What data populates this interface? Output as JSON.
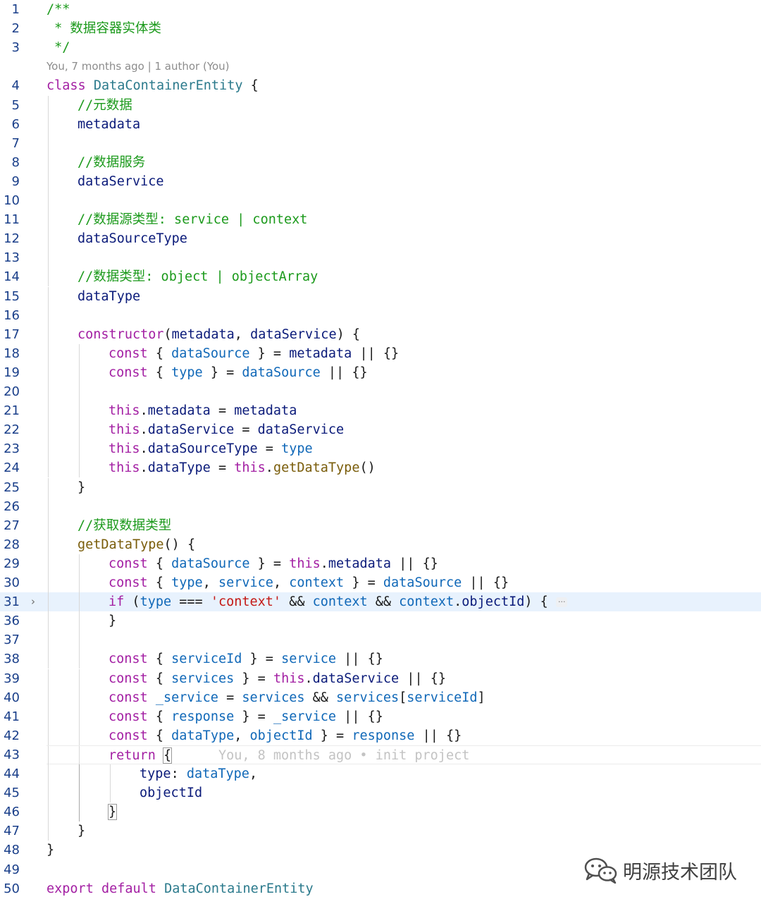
{
  "colors": {
    "keyword": "#a31fa3",
    "plain": "#0b1b7a",
    "property": "#1068b8",
    "type": "#2b7a8c",
    "comment": "#1c9a1c",
    "string": "#c41a16",
    "function": "#7a5d0b",
    "punct": "#1a1a1a",
    "blame": "#c3c3c3"
  },
  "codelens": {
    "after_line": 3,
    "text": "You, 7 months ago | 1 author (You)"
  },
  "inline_blame": "You, 8 months ago • init project",
  "watermark": {
    "icon": "wechat-icon",
    "text": "明源技术团队"
  },
  "lines": [
    {
      "n": "1",
      "indent": 0,
      "tokens": [
        {
          "t": "/**",
          "c": "comment"
        }
      ]
    },
    {
      "n": "2",
      "indent": 0,
      "tokens": [
        {
          "t": " * 数据容器实体类",
          "c": "comment"
        }
      ]
    },
    {
      "n": "3",
      "indent": 0,
      "tokens": [
        {
          "t": " */",
          "c": "comment"
        }
      ]
    },
    {
      "n": "4",
      "indent": 0,
      "tokens": [
        {
          "t": "class",
          "c": "keyword"
        },
        {
          "t": " ",
          "c": "punct"
        },
        {
          "t": "DataContainerEntity",
          "c": "type"
        },
        {
          "t": " {",
          "c": "punct"
        }
      ]
    },
    {
      "n": "5",
      "indent": 1,
      "tokens": [
        {
          "t": "//元数据",
          "c": "comment"
        }
      ]
    },
    {
      "n": "6",
      "indent": 1,
      "tokens": [
        {
          "t": "metadata",
          "c": "plain"
        }
      ]
    },
    {
      "n": "7",
      "indent": 1,
      "tokens": []
    },
    {
      "n": "8",
      "indent": 1,
      "tokens": [
        {
          "t": "//数据服务",
          "c": "comment"
        }
      ]
    },
    {
      "n": "9",
      "indent": 1,
      "tokens": [
        {
          "t": "dataService",
          "c": "plain"
        }
      ]
    },
    {
      "n": "10",
      "indent": 1,
      "tokens": []
    },
    {
      "n": "11",
      "indent": 1,
      "tokens": [
        {
          "t": "//数据源类型: service | context",
          "c": "comment"
        }
      ]
    },
    {
      "n": "12",
      "indent": 1,
      "tokens": [
        {
          "t": "dataSourceType",
          "c": "plain"
        }
      ]
    },
    {
      "n": "13",
      "indent": 1,
      "tokens": []
    },
    {
      "n": "14",
      "indent": 1,
      "tokens": [
        {
          "t": "//数据类型: object | objectArray",
          "c": "comment"
        }
      ]
    },
    {
      "n": "15",
      "indent": 1,
      "tokens": [
        {
          "t": "dataType",
          "c": "plain"
        }
      ]
    },
    {
      "n": "16",
      "indent": 1,
      "tokens": []
    },
    {
      "n": "17",
      "indent": 1,
      "tokens": [
        {
          "t": "constructor",
          "c": "keyword"
        },
        {
          "t": "(",
          "c": "punct"
        },
        {
          "t": "metadata",
          "c": "plain"
        },
        {
          "t": ", ",
          "c": "punct"
        },
        {
          "t": "dataService",
          "c": "plain"
        },
        {
          "t": ") {",
          "c": "punct"
        }
      ]
    },
    {
      "n": "18",
      "indent": 2,
      "tokens": [
        {
          "t": "const",
          "c": "keyword"
        },
        {
          "t": " { ",
          "c": "punct"
        },
        {
          "t": "dataSource",
          "c": "property"
        },
        {
          "t": " } = ",
          "c": "punct"
        },
        {
          "t": "metadata",
          "c": "plain"
        },
        {
          "t": " || {}",
          "c": "punct"
        }
      ]
    },
    {
      "n": "19",
      "indent": 2,
      "tokens": [
        {
          "t": "const",
          "c": "keyword"
        },
        {
          "t": " { ",
          "c": "punct"
        },
        {
          "t": "type",
          "c": "property"
        },
        {
          "t": " } = ",
          "c": "punct"
        },
        {
          "t": "dataSource",
          "c": "property"
        },
        {
          "t": " || {}",
          "c": "punct"
        }
      ]
    },
    {
      "n": "20",
      "indent": 2,
      "tokens": []
    },
    {
      "n": "21",
      "indent": 2,
      "tokens": [
        {
          "t": "this",
          "c": "keyword"
        },
        {
          "t": ".",
          "c": "punct"
        },
        {
          "t": "metadata",
          "c": "plain"
        },
        {
          "t": " = ",
          "c": "punct"
        },
        {
          "t": "metadata",
          "c": "plain"
        }
      ]
    },
    {
      "n": "22",
      "indent": 2,
      "tokens": [
        {
          "t": "this",
          "c": "keyword"
        },
        {
          "t": ".",
          "c": "punct"
        },
        {
          "t": "dataService",
          "c": "plain"
        },
        {
          "t": " = ",
          "c": "punct"
        },
        {
          "t": "dataService",
          "c": "plain"
        }
      ]
    },
    {
      "n": "23",
      "indent": 2,
      "tokens": [
        {
          "t": "this",
          "c": "keyword"
        },
        {
          "t": ".",
          "c": "punct"
        },
        {
          "t": "dataSourceType",
          "c": "plain"
        },
        {
          "t": " = ",
          "c": "punct"
        },
        {
          "t": "type",
          "c": "property"
        }
      ]
    },
    {
      "n": "24",
      "indent": 2,
      "tokens": [
        {
          "t": "this",
          "c": "keyword"
        },
        {
          "t": ".",
          "c": "punct"
        },
        {
          "t": "dataType",
          "c": "plain"
        },
        {
          "t": " = ",
          "c": "punct"
        },
        {
          "t": "this",
          "c": "keyword"
        },
        {
          "t": ".",
          "c": "punct"
        },
        {
          "t": "getDataType",
          "c": "function"
        },
        {
          "t": "()",
          "c": "punct"
        }
      ]
    },
    {
      "n": "25",
      "indent": 1,
      "tokens": [
        {
          "t": "}",
          "c": "punct"
        }
      ]
    },
    {
      "n": "26",
      "indent": 1,
      "tokens": []
    },
    {
      "n": "27",
      "indent": 1,
      "tokens": [
        {
          "t": "//获取数据类型",
          "c": "comment"
        }
      ]
    },
    {
      "n": "28",
      "indent": 1,
      "tokens": [
        {
          "t": "getDataType",
          "c": "function"
        },
        {
          "t": "() {",
          "c": "punct"
        }
      ]
    },
    {
      "n": "29",
      "indent": 2,
      "tokens": [
        {
          "t": "const",
          "c": "keyword"
        },
        {
          "t": " { ",
          "c": "punct"
        },
        {
          "t": "dataSource",
          "c": "property"
        },
        {
          "t": " } = ",
          "c": "punct"
        },
        {
          "t": "this",
          "c": "keyword"
        },
        {
          "t": ".",
          "c": "punct"
        },
        {
          "t": "metadata",
          "c": "plain"
        },
        {
          "t": " || {}",
          "c": "punct"
        }
      ]
    },
    {
      "n": "30",
      "indent": 2,
      "tokens": [
        {
          "t": "const",
          "c": "keyword"
        },
        {
          "t": " { ",
          "c": "punct"
        },
        {
          "t": "type",
          "c": "property"
        },
        {
          "t": ", ",
          "c": "punct"
        },
        {
          "t": "service",
          "c": "property"
        },
        {
          "t": ", ",
          "c": "punct"
        },
        {
          "t": "context",
          "c": "property"
        },
        {
          "t": " } = ",
          "c": "punct"
        },
        {
          "t": "dataSource",
          "c": "property"
        },
        {
          "t": " || {}",
          "c": "punct"
        }
      ]
    },
    {
      "n": "31",
      "indent": 2,
      "fold": "›",
      "highlight": true,
      "ellipsis": "···",
      "tokens": [
        {
          "t": "if",
          "c": "keyword"
        },
        {
          "t": " (",
          "c": "punct"
        },
        {
          "t": "type",
          "c": "property"
        },
        {
          "t": " === ",
          "c": "punct"
        },
        {
          "t": "'context'",
          "c": "string"
        },
        {
          "t": " && ",
          "c": "punct"
        },
        {
          "t": "context",
          "c": "property"
        },
        {
          "t": " && ",
          "c": "punct"
        },
        {
          "t": "context",
          "c": "property"
        },
        {
          "t": ".",
          "c": "punct"
        },
        {
          "t": "objectId",
          "c": "plain"
        },
        {
          "t": ") {",
          "c": "punct"
        }
      ]
    },
    {
      "n": "36",
      "indent": 2,
      "tokens": [
        {
          "t": "}",
          "c": "punct"
        }
      ]
    },
    {
      "n": "37",
      "indent": 2,
      "tokens": []
    },
    {
      "n": "38",
      "indent": 2,
      "tokens": [
        {
          "t": "const",
          "c": "keyword"
        },
        {
          "t": " { ",
          "c": "punct"
        },
        {
          "t": "serviceId",
          "c": "property"
        },
        {
          "t": " } = ",
          "c": "punct"
        },
        {
          "t": "service",
          "c": "property"
        },
        {
          "t": " || {}",
          "c": "punct"
        }
      ]
    },
    {
      "n": "39",
      "indent": 2,
      "tokens": [
        {
          "t": "const",
          "c": "keyword"
        },
        {
          "t": " { ",
          "c": "punct"
        },
        {
          "t": "services",
          "c": "property"
        },
        {
          "t": " } = ",
          "c": "punct"
        },
        {
          "t": "this",
          "c": "keyword"
        },
        {
          "t": ".",
          "c": "punct"
        },
        {
          "t": "dataService",
          "c": "plain"
        },
        {
          "t": " || {}",
          "c": "punct"
        }
      ]
    },
    {
      "n": "40",
      "indent": 2,
      "tokens": [
        {
          "t": "const",
          "c": "keyword"
        },
        {
          "t": " ",
          "c": "punct"
        },
        {
          "t": "_service",
          "c": "property"
        },
        {
          "t": " = ",
          "c": "punct"
        },
        {
          "t": "services",
          "c": "property"
        },
        {
          "t": " && ",
          "c": "punct"
        },
        {
          "t": "services",
          "c": "property"
        },
        {
          "t": "[",
          "c": "punct"
        },
        {
          "t": "serviceId",
          "c": "property"
        },
        {
          "t": "]",
          "c": "punct"
        }
      ]
    },
    {
      "n": "41",
      "indent": 2,
      "tokens": [
        {
          "t": "const",
          "c": "keyword"
        },
        {
          "t": " { ",
          "c": "punct"
        },
        {
          "t": "response",
          "c": "property"
        },
        {
          "t": " } = ",
          "c": "punct"
        },
        {
          "t": "_service",
          "c": "property"
        },
        {
          "t": " || {}",
          "c": "punct"
        }
      ]
    },
    {
      "n": "42",
      "indent": 2,
      "tokens": [
        {
          "t": "const",
          "c": "keyword"
        },
        {
          "t": " { ",
          "c": "punct"
        },
        {
          "t": "dataType",
          "c": "property"
        },
        {
          "t": ", ",
          "c": "punct"
        },
        {
          "t": "objectId",
          "c": "property"
        },
        {
          "t": " } = ",
          "c": "punct"
        },
        {
          "t": "response",
          "c": "property"
        },
        {
          "t": " || {}",
          "c": "punct"
        }
      ]
    },
    {
      "n": "43",
      "indent": 2,
      "current": true,
      "blame": true,
      "tokens": [
        {
          "t": "return",
          "c": "keyword"
        },
        {
          "t": " ",
          "c": "punct"
        },
        {
          "t": "{",
          "c": "punct",
          "box": true
        }
      ]
    },
    {
      "n": "44",
      "indent": 3,
      "tokens": [
        {
          "t": "type",
          "c": "plain"
        },
        {
          "t": ": ",
          "c": "punct"
        },
        {
          "t": "dataType",
          "c": "property"
        },
        {
          "t": ",",
          "c": "punct"
        }
      ]
    },
    {
      "n": "45",
      "indent": 3,
      "tokens": [
        {
          "t": "objectId",
          "c": "plain"
        }
      ]
    },
    {
      "n": "46",
      "indent": 2,
      "tokens": [
        {
          "t": "}",
          "c": "punct",
          "box": true
        }
      ]
    },
    {
      "n": "47",
      "indent": 1,
      "tokens": [
        {
          "t": "}",
          "c": "punct"
        }
      ]
    },
    {
      "n": "48",
      "indent": 0,
      "tokens": [
        {
          "t": "}",
          "c": "punct"
        }
      ]
    },
    {
      "n": "49",
      "indent": 0,
      "tokens": []
    },
    {
      "n": "50",
      "indent": 0,
      "tokens": [
        {
          "t": "export",
          "c": "keyword"
        },
        {
          "t": " ",
          "c": "punct"
        },
        {
          "t": "default",
          "c": "keyword"
        },
        {
          "t": " ",
          "c": "punct"
        },
        {
          "t": "DataContainerEntity",
          "c": "type"
        }
      ]
    }
  ]
}
